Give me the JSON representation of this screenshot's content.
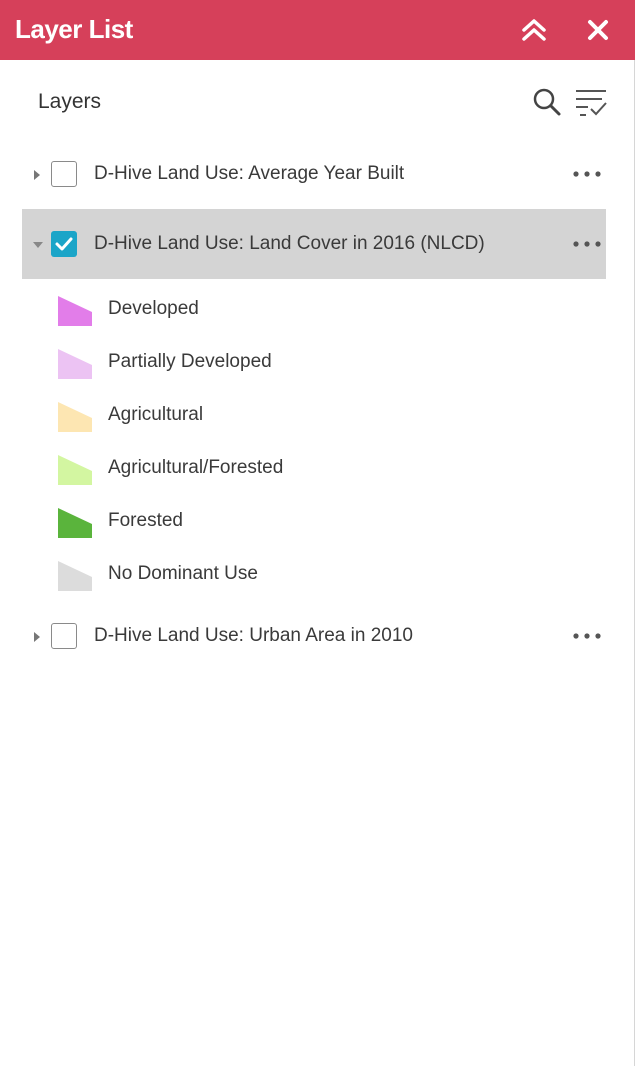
{
  "panel": {
    "title": "Layer List",
    "accent_color": "#d6405a",
    "collapse_icon": "chevron-double-up-icon",
    "close_icon": "close-icon"
  },
  "header": {
    "title": "Layers",
    "search_icon": "search-icon",
    "filter_icon": "filter-list-icon"
  },
  "layers": [
    {
      "label": "D-Hive Land Use: Average Year Built",
      "checked": false,
      "expanded": false
    },
    {
      "label": "D-Hive Land Use: Land Cover in 2016 (NLCD)",
      "checked": true,
      "expanded": true
    },
    {
      "label": "D-Hive Land Use: Urban Area in 2010",
      "checked": false,
      "expanded": false
    }
  ],
  "legend": [
    {
      "label": "Developed",
      "color": "#e27de9"
    },
    {
      "label": "Partially Developed",
      "color": "#ecc3f3"
    },
    {
      "label": "Agricultural",
      "color": "#fde6b2"
    },
    {
      "label": "Agricultural/Forested",
      "color": "#d3f6a1"
    },
    {
      "label": "Forested",
      "color": "#5ab43c"
    },
    {
      "label": "No Dominant Use",
      "color": "#dcdcdc"
    }
  ]
}
